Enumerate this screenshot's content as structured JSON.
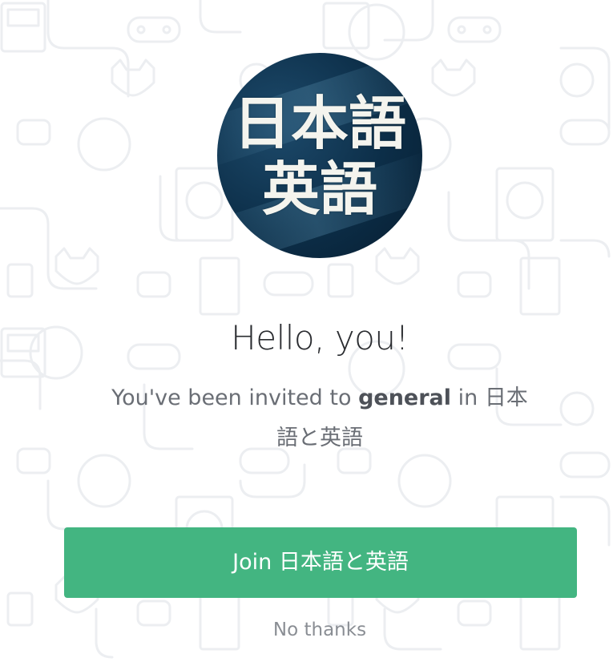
{
  "server": {
    "icon_line_1": "日本語",
    "icon_line_2": "英語",
    "name": "日本語と英語"
  },
  "invite": {
    "greeting": "Hello, you!",
    "text_prefix": "You've been invited to ",
    "channel": "general",
    "text_middle": " in ",
    "server_name": "日本語と英語"
  },
  "actions": {
    "join_label": "Join 日本語と英語",
    "decline_label": "No thanks"
  },
  "colors": {
    "accept_button": "#43b581",
    "background": "#ffffff",
    "pattern": "#eef0f3"
  }
}
